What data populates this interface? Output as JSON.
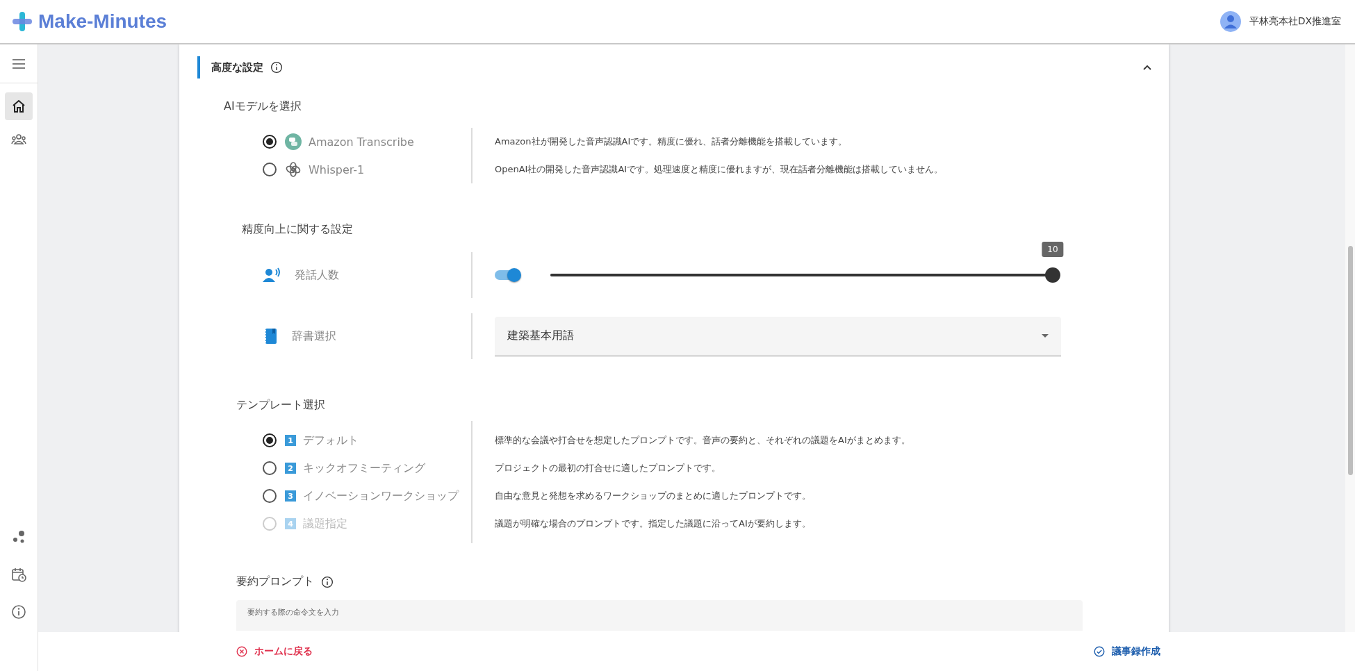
{
  "header": {
    "logo": "Make-Minutes",
    "user": "平林亮本社DX推進室"
  },
  "sidebar": {
    "items": [
      {
        "kind": "home",
        "selected": true
      },
      {
        "kind": "people",
        "selected": false
      }
    ],
    "bottom_items": [
      {
        "kind": "dots"
      },
      {
        "kind": "calendar"
      },
      {
        "kind": "info"
      }
    ]
  },
  "panel": {
    "title": "高度な設定",
    "expanded": true
  },
  "ai_model": {
    "heading": "AIモデルを選択",
    "options": [
      {
        "kind": "transcribe",
        "label": "Amazon Transcribe",
        "description": "Amazon社が開発した音声認識AIです。精度に優れ、話者分離機能を搭載しています。",
        "selected": true
      },
      {
        "kind": "whisper",
        "label": "Whisper-1",
        "description": "OpenAI社の開発した音声認識AIです。処理速度と精度に優れますが、現在話者分離機能は搭載していません。",
        "selected": false
      }
    ]
  },
  "accuracy": {
    "heading": "精度向上に関する設定",
    "speakers": {
      "label": "発話人数",
      "on": true,
      "level": 1,
      "reading": "10"
    },
    "dictionary": {
      "label": "辞書選択",
      "value": "建築基本用語"
    }
  },
  "templates": {
    "heading": "テンプレート選択",
    "options": [
      {
        "number": "1",
        "label": "デフォルト",
        "description": "標準的な会議や打合せを想定したプロンプトです。音声の要約と、それぞれの議題をAIがまとめます。",
        "selected": true,
        "disabled": false
      },
      {
        "number": "2",
        "label": "キックオフミーティング",
        "description": "プロジェクトの最初の打合せに適したプロンプトです。",
        "selected": false,
        "disabled": false
      },
      {
        "number": "3",
        "label": "イノベーションワークショップ",
        "description": "自由な意見と発想を求めるワークショップのまとめに適したプロンプトです。",
        "selected": false,
        "disabled": false
      },
      {
        "number": "4",
        "label": "議題指定",
        "description": "議題が明確な場合のプロンプトです。指定した議題に沿ってAIが要約します。",
        "selected": false,
        "disabled": true
      }
    ]
  },
  "prompt": {
    "heading": "要約プロンプト",
    "field_label": "要約する際の命令文を入力"
  },
  "footer": {
    "back": "ホームに戻る",
    "create": "議事録作成"
  }
}
